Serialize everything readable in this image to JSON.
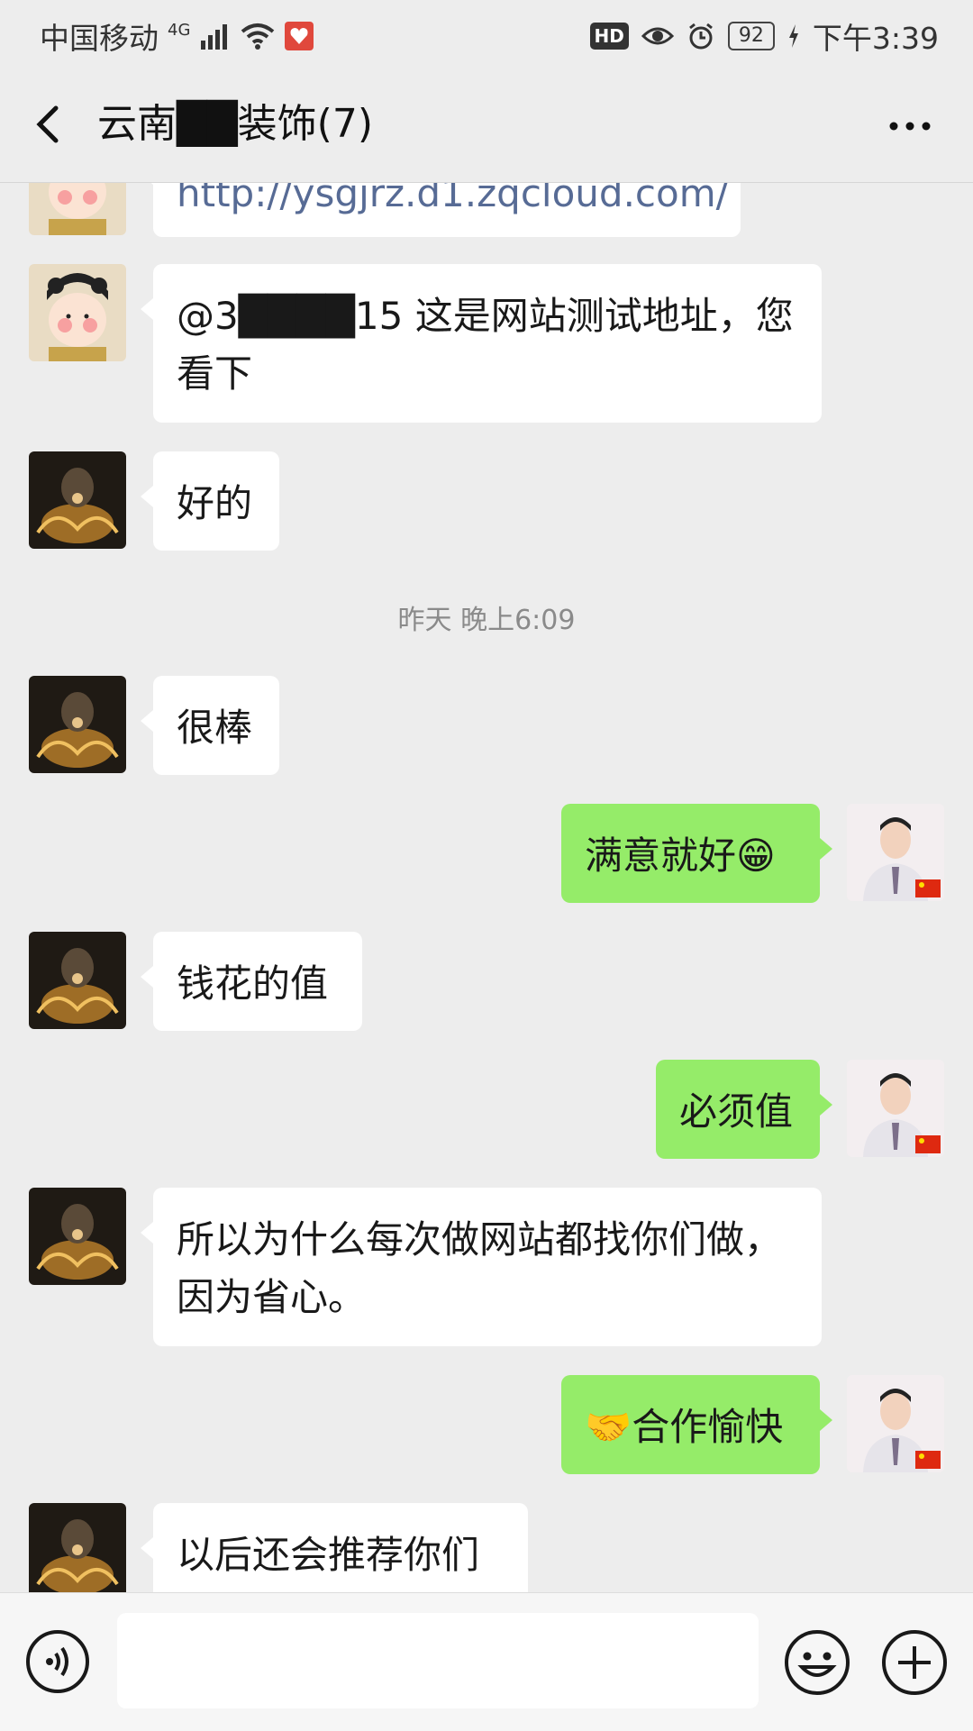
{
  "status_bar": {
    "carrier": "中国移动",
    "network": "4G",
    "hd": "HD",
    "battery": "92",
    "time": "下午3:39"
  },
  "header": {
    "title": "云南██装饰(7)"
  },
  "messages": [
    {
      "side": "left",
      "avatar": "avatar-female-cartoon",
      "text": "http://ysgjrz.d1.zqcloud.com/",
      "is_link": true
    },
    {
      "side": "left",
      "avatar": "avatar-female-cartoon",
      "text": "@3████15 这是网站测试地址，您看下"
    },
    {
      "side": "left",
      "avatar": "avatar-dark-fire",
      "text": "好的"
    },
    {
      "timestamp": "昨天 晚上6:09"
    },
    {
      "side": "left",
      "avatar": "avatar-dark-fire",
      "text": "很棒"
    },
    {
      "side": "right",
      "avatar": "avatar-man-suit",
      "text": "满意就好😁"
    },
    {
      "side": "left",
      "avatar": "avatar-dark-fire",
      "text": "钱花的值"
    },
    {
      "side": "right",
      "avatar": "avatar-man-suit",
      "text": "必须值"
    },
    {
      "side": "left",
      "avatar": "avatar-dark-fire",
      "text": "所以为什么每次做网站都找你们做，因为省心。"
    },
    {
      "side": "right",
      "avatar": "avatar-man-suit",
      "text": "🤝合作愉快"
    },
    {
      "side": "left",
      "avatar": "avatar-dark-fire",
      "text": "以后还会推荐你们"
    }
  ],
  "colors": {
    "background": "#ededed",
    "my_bubble": "#95ec69",
    "other_bubble": "#ffffff",
    "link": "#576b95"
  },
  "icons": [
    "back-icon",
    "more-icon",
    "voice-icon",
    "emoji-icon",
    "plus-icon"
  ]
}
